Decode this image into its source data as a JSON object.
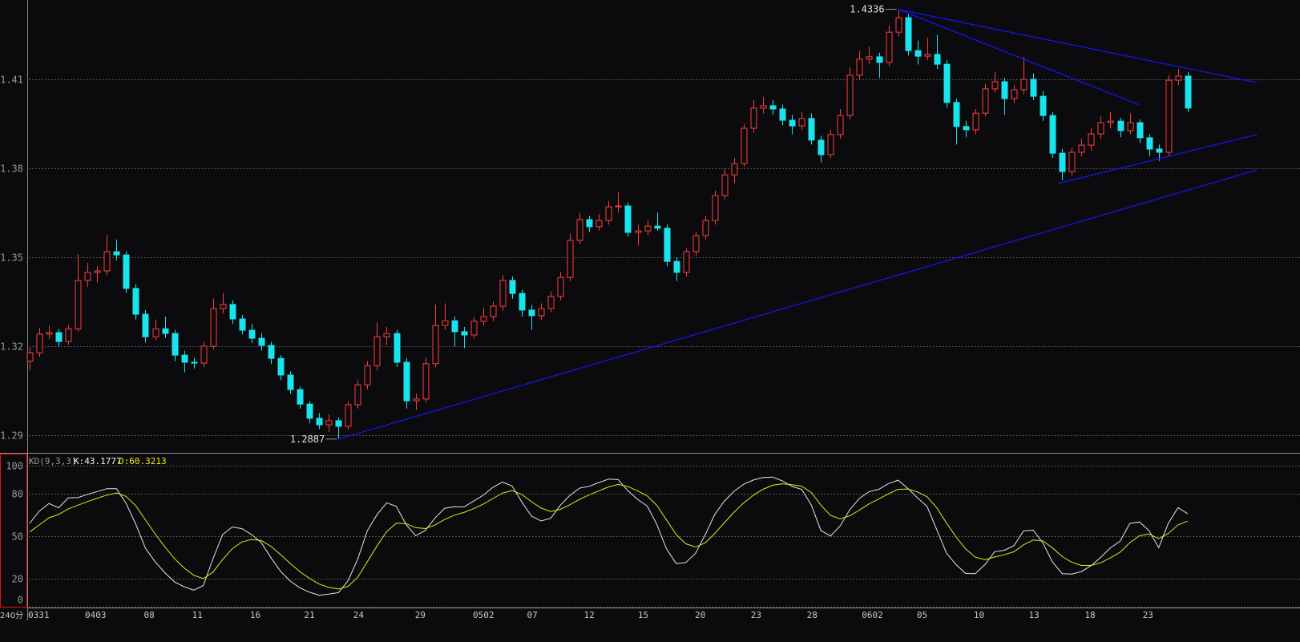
{
  "period_label": "240分",
  "colors": {
    "background": "#0b0b0e",
    "up": "#ff3d3d",
    "down": "#19e3ec",
    "trendline": "#1414ff",
    "k_line": "#e6e6e6",
    "d_line": "#e6e619",
    "grid": "#555555",
    "axis_text": "#9a9a9a",
    "kd_panel_border": "#e01010"
  },
  "indicator": {
    "name": "KD(9,3,3)",
    "k_label": "K:43.1777",
    "d_label": "D:60.3213"
  },
  "chart_data": [
    {
      "type": "candlestick",
      "title": "",
      "price_ticks": [
        1.29,
        1.32,
        1.35,
        1.38,
        1.41
      ],
      "price_tick_labels": [
        "1.29",
        "1.32",
        "1.35",
        "1.38",
        "1.41"
      ],
      "grid": true,
      "annotations": [
        {
          "text": "1.4336",
          "bar": 90,
          "price": 1.4336
        },
        {
          "text": "1.2887",
          "bar": 32,
          "price": 1.2887
        }
      ],
      "date_labels": [
        {
          "text": "0331",
          "bar": 0
        },
        {
          "text": "0403",
          "bar": 5.9
        },
        {
          "text": "08",
          "bar": 12
        },
        {
          "text": "11",
          "bar": 17
        },
        {
          "text": "16",
          "bar": 23
        },
        {
          "text": "21",
          "bar": 28.6
        },
        {
          "text": "24",
          "bar": 33.7
        },
        {
          "text": "29",
          "bar": 40.1
        },
        {
          "text": "0502",
          "bar": 46.1
        },
        {
          "text": "07",
          "bar": 51.7
        },
        {
          "text": "12",
          "bar": 57.6
        },
        {
          "text": "15",
          "bar": 63.2
        },
        {
          "text": "20",
          "bar": 69.1
        },
        {
          "text": "23",
          "bar": 74.9
        },
        {
          "text": "28",
          "bar": 80.7
        },
        {
          "text": "0602",
          "bar": 86.4
        },
        {
          "text": "05",
          "bar": 92.1
        },
        {
          "text": "10",
          "bar": 98
        },
        {
          "text": "13",
          "bar": 103.7
        },
        {
          "text": "18",
          "bar": 109.5
        },
        {
          "text": "23",
          "bar": 115.5
        }
      ],
      "trendlines": [
        {
          "from": {
            "bar": 32,
            "price": 1.2887
          },
          "to": {
            "bar": 127.2,
            "price": 1.3795
          }
        },
        {
          "from": {
            "bar": 90,
            "price": 1.4336
          },
          "to": {
            "bar": 127.2,
            "price": 1.4089
          }
        },
        {
          "from": {
            "bar": 90,
            "price": 1.4336
          },
          "to": {
            "bar": 115.0,
            "price": 1.4014
          }
        },
        {
          "from": {
            "bar": 106.6,
            "price": 1.3749
          },
          "to": {
            "bar": 127.2,
            "price": 1.3914
          }
        }
      ],
      "ohlc": [
        [
          1.315,
          1.3195,
          1.312,
          1.3178
        ],
        [
          1.3178,
          1.3262,
          1.3165,
          1.3241
        ],
        [
          1.3241,
          1.327,
          1.3225,
          1.3246
        ],
        [
          1.3246,
          1.3258,
          1.3198,
          1.3216
        ],
        [
          1.3216,
          1.3272,
          1.3205,
          1.3259
        ],
        [
          1.3259,
          1.351,
          1.325,
          1.3422
        ],
        [
          1.3422,
          1.348,
          1.34,
          1.3449
        ],
        [
          1.3449,
          1.347,
          1.3415,
          1.3454
        ],
        [
          1.3454,
          1.3575,
          1.344,
          1.3519
        ],
        [
          1.3519,
          1.356,
          1.349,
          1.3508
        ],
        [
          1.3508,
          1.352,
          1.338,
          1.3395
        ],
        [
          1.3395,
          1.341,
          1.329,
          1.3308
        ],
        [
          1.3308,
          1.3322,
          1.3212,
          1.3232
        ],
        [
          1.3232,
          1.329,
          1.322,
          1.3259
        ],
        [
          1.3259,
          1.33,
          1.3228,
          1.3243
        ],
        [
          1.3243,
          1.3255,
          1.315,
          1.317
        ],
        [
          1.317,
          1.3185,
          1.3112,
          1.3146
        ],
        [
          1.3146,
          1.316,
          1.3125,
          1.3143
        ],
        [
          1.3143,
          1.3215,
          1.313,
          1.32
        ],
        [
          1.32,
          1.336,
          1.319,
          1.3327
        ],
        [
          1.3327,
          1.338,
          1.331,
          1.3341
        ],
        [
          1.3341,
          1.3355,
          1.3275,
          1.3292
        ],
        [
          1.3292,
          1.3305,
          1.324,
          1.3254
        ],
        [
          1.3254,
          1.3275,
          1.321,
          1.3227
        ],
        [
          1.3227,
          1.3245,
          1.3185,
          1.3203
        ],
        [
          1.3203,
          1.3215,
          1.314,
          1.3159
        ],
        [
          1.3159,
          1.317,
          1.3085,
          1.3103
        ],
        [
          1.3103,
          1.3115,
          1.304,
          1.3054
        ],
        [
          1.3054,
          1.3065,
          1.299,
          1.3005
        ],
        [
          1.3005,
          1.3015,
          1.294,
          1.2957
        ],
        [
          1.2957,
          1.2975,
          1.292,
          1.2935
        ],
        [
          1.2935,
          1.297,
          1.291,
          1.2949
        ],
        [
          1.2949,
          1.296,
          1.2887,
          1.293
        ],
        [
          1.293,
          1.3015,
          1.2918,
          1.3003
        ],
        [
          1.3003,
          1.3085,
          1.299,
          1.307
        ],
        [
          1.307,
          1.315,
          1.3055,
          1.3135
        ],
        [
          1.3135,
          1.328,
          1.312,
          1.3232
        ],
        [
          1.3232,
          1.3265,
          1.3205,
          1.3243
        ],
        [
          1.3243,
          1.3255,
          1.313,
          1.3146
        ],
        [
          1.3146,
          1.316,
          1.299,
          1.3016
        ],
        [
          1.3016,
          1.304,
          1.2985,
          1.3022
        ],
        [
          1.3022,
          1.316,
          1.301,
          1.3141
        ],
        [
          1.3141,
          1.334,
          1.313,
          1.327
        ],
        [
          1.327,
          1.3345,
          1.3255,
          1.3286
        ],
        [
          1.3286,
          1.33,
          1.32,
          1.3249
        ],
        [
          1.3249,
          1.3265,
          1.3195,
          1.3238
        ],
        [
          1.3238,
          1.33,
          1.3225,
          1.3284
        ],
        [
          1.3284,
          1.333,
          1.327,
          1.33
        ],
        [
          1.33,
          1.335,
          1.3285,
          1.3335
        ],
        [
          1.3335,
          1.344,
          1.332,
          1.3422
        ],
        [
          1.3422,
          1.3435,
          1.336,
          1.3378
        ],
        [
          1.3378,
          1.339,
          1.33,
          1.3322
        ],
        [
          1.3322,
          1.334,
          1.3255,
          1.3303
        ],
        [
          1.3303,
          1.3345,
          1.329,
          1.3327
        ],
        [
          1.3327,
          1.3385,
          1.3315,
          1.3368
        ],
        [
          1.3368,
          1.345,
          1.3355,
          1.3432
        ],
        [
          1.3432,
          1.358,
          1.342,
          1.3557
        ],
        [
          1.3557,
          1.365,
          1.3545,
          1.3627
        ],
        [
          1.3627,
          1.364,
          1.3585,
          1.3603
        ],
        [
          1.3603,
          1.3645,
          1.359,
          1.3624
        ],
        [
          1.3624,
          1.369,
          1.361,
          1.367
        ],
        [
          1.367,
          1.372,
          1.365,
          1.3673
        ],
        [
          1.3673,
          1.3685,
          1.357,
          1.3584
        ],
        [
          1.3584,
          1.361,
          1.354,
          1.3589
        ],
        [
          1.3589,
          1.3625,
          1.3575,
          1.3605
        ],
        [
          1.3605,
          1.365,
          1.359,
          1.3598
        ],
        [
          1.3598,
          1.361,
          1.347,
          1.3486
        ],
        [
          1.3486,
          1.35,
          1.342,
          1.3449
        ],
        [
          1.3449,
          1.353,
          1.3435,
          1.3519
        ],
        [
          1.3519,
          1.3585,
          1.3505,
          1.3573
        ],
        [
          1.3573,
          1.364,
          1.356,
          1.3624
        ],
        [
          1.3624,
          1.3725,
          1.361,
          1.3708
        ],
        [
          1.3708,
          1.38,
          1.3695,
          1.3778
        ],
        [
          1.3778,
          1.3835,
          1.375,
          1.3816
        ],
        [
          1.3816,
          1.395,
          1.3805,
          1.3935
        ],
        [
          1.3935,
          1.403,
          1.392,
          1.4003
        ],
        [
          1.4003,
          1.404,
          1.3985,
          1.4011
        ],
        [
          1.4011,
          1.403,
          1.398,
          1.4
        ],
        [
          1.4,
          1.4015,
          1.3945,
          1.3962
        ],
        [
          1.3962,
          1.398,
          1.3915,
          1.3943
        ],
        [
          1.3943,
          1.399,
          1.393,
          1.3968
        ],
        [
          1.3968,
          1.3985,
          1.388,
          1.3895
        ],
        [
          1.3895,
          1.391,
          1.382,
          1.3846
        ],
        [
          1.3846,
          1.393,
          1.3835,
          1.3914
        ],
        [
          1.3914,
          1.4,
          1.39,
          1.3978
        ],
        [
          1.3978,
          1.414,
          1.3965,
          1.4114
        ],
        [
          1.4114,
          1.4195,
          1.41,
          1.4168
        ],
        [
          1.4168,
          1.421,
          1.415,
          1.4176
        ],
        [
          1.4176,
          1.419,
          1.4105,
          1.4157
        ],
        [
          1.4157,
          1.428,
          1.4145,
          1.4259
        ],
        [
          1.4259,
          1.4336,
          1.4245,
          1.4308
        ],
        [
          1.4308,
          1.432,
          1.418,
          1.4197
        ],
        [
          1.4197,
          1.423,
          1.415,
          1.4178
        ],
        [
          1.4178,
          1.424,
          1.4165,
          1.4184
        ],
        [
          1.4184,
          1.425,
          1.4135,
          1.4151
        ],
        [
          1.4151,
          1.4165,
          1.4005,
          1.4022
        ],
        [
          1.4022,
          1.4035,
          1.388,
          1.3941
        ],
        [
          1.3941,
          1.396,
          1.3905,
          1.393
        ],
        [
          1.393,
          1.4,
          1.3915,
          1.3986
        ],
        [
          1.3986,
          1.4085,
          1.3975,
          1.4068
        ],
        [
          1.4068,
          1.4125,
          1.4055,
          1.4092
        ],
        [
          1.4092,
          1.4105,
          1.398,
          1.4035
        ],
        [
          1.4035,
          1.408,
          1.402,
          1.4065
        ],
        [
          1.4065,
          1.4175,
          1.405,
          1.41
        ],
        [
          1.41,
          1.412,
          1.403,
          1.4043
        ],
        [
          1.4043,
          1.406,
          1.396,
          1.3978
        ],
        [
          1.3978,
          1.399,
          1.3835,
          1.3851
        ],
        [
          1.3851,
          1.3865,
          1.376,
          1.3789
        ],
        [
          1.3789,
          1.387,
          1.3775,
          1.3854
        ],
        [
          1.3854,
          1.39,
          1.384,
          1.3878
        ],
        [
          1.3878,
          1.3935,
          1.386,
          1.3916
        ],
        [
          1.3916,
          1.3975,
          1.39,
          1.3954
        ],
        [
          1.3954,
          1.399,
          1.3935,
          1.3959
        ],
        [
          1.3959,
          1.397,
          1.3905,
          1.3927
        ],
        [
          1.3927,
          1.3985,
          1.3915,
          1.3954
        ],
        [
          1.3954,
          1.3965,
          1.3885,
          1.3903
        ],
        [
          1.3903,
          1.3915,
          1.384,
          1.3865
        ],
        [
          1.3865,
          1.388,
          1.3825,
          1.3854
        ],
        [
          1.3854,
          1.4115,
          1.384,
          1.4097
        ],
        [
          1.4097,
          1.4135,
          1.408,
          1.4111
        ],
        [
          1.4111,
          1.4125,
          1.399,
          1.4003
        ]
      ]
    },
    {
      "type": "line",
      "title": "KD(9,3,3)",
      "ylim": [
        0,
        100
      ],
      "y_ticks": [
        0,
        20,
        50,
        80,
        100
      ],
      "y_tick_labels": [
        "0",
        "20",
        "50",
        "80",
        "100"
      ],
      "grid": true,
      "series": [
        {
          "name": "K"
        },
        {
          "name": "D"
        }
      ],
      "params": {
        "n": 9,
        "m1": 3,
        "m2": 3
      }
    }
  ]
}
